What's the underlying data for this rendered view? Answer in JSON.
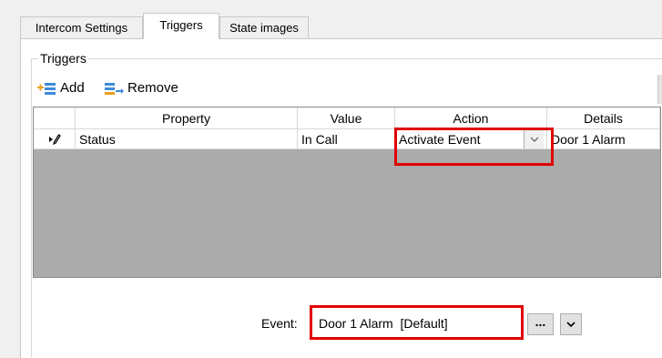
{
  "tabs": [
    {
      "label": "Intercom Settings",
      "active": false
    },
    {
      "label": "Triggers",
      "active": true
    },
    {
      "label": "State images",
      "active": false
    }
  ],
  "group": {
    "title": "Triggers"
  },
  "toolbar": {
    "add_label": "Add",
    "remove_label": "Remove",
    "add_icon": "add-row-icon",
    "remove_icon": "remove-row-icon"
  },
  "grid": {
    "columns": [
      "Property",
      "Value",
      "Action",
      "Details"
    ],
    "rows": [
      {
        "property": "Status",
        "value": "In Call",
        "action": "Activate Event",
        "details": "Door 1 Alarm",
        "row_icon": "edit-row-pencil-icon"
      }
    ]
  },
  "event": {
    "label": "Event:",
    "value": "Door 1 Alarm  [Default]",
    "browse_label": "..."
  },
  "colors": {
    "highlight": "#e00000",
    "grid_empty": "#ababab"
  }
}
